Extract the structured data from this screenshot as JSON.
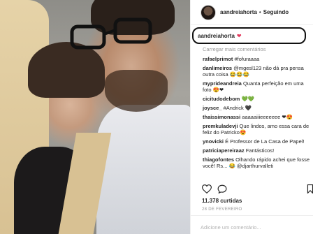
{
  "post": {
    "username": "aandreiahorta",
    "separator": "•",
    "follow_status": "Seguindo",
    "caption_username": "aandreiahorta",
    "caption_emoji": "❤",
    "load_more": "Carregar mais comentários",
    "comments": [
      {
        "user": "rafaelprimot",
        "text": "#fofuraaaa"
      },
      {
        "user": "danlimeiros",
        "text": "@mgesl123 não dá pra pensa outra coisa 😂😂😂"
      },
      {
        "user": "myprideandreia",
        "text": "Quanta perfeição em uma foto 😍❤"
      },
      {
        "user": "cicitudodebom",
        "text": "💚💚"
      },
      {
        "user": "joysce_",
        "text": "#Andrick 🖤"
      },
      {
        "user": "thaissimonassi",
        "text": "aaaaaiiieeeeeee ❤😍"
      },
      {
        "user": "premkuladevji",
        "text": "Que lindos, amo essa cara de feliz do Patricko😍"
      },
      {
        "user": "ynovicki",
        "text": "É Professor de La Casa de Papel!"
      },
      {
        "user": "patriciapereiraaz",
        "text": "Fantásticos!"
      },
      {
        "user": "thiagofontes",
        "text": "Olhando rápido achei que fosse você! Rs... 😂 @djarthurvalleti"
      }
    ],
    "likes": "11.378 curtidas",
    "date": "28 DE FEVEREIRO",
    "add_comment_placeholder": "Adicione um comentário..."
  },
  "icons": {
    "like": "heart-outline-icon",
    "comment": "speech-bubble-icon",
    "save": "bookmark-icon"
  },
  "colors": {
    "text": "#262626",
    "muted": "#999999",
    "border": "#efefef",
    "heart": "#e3385c"
  }
}
